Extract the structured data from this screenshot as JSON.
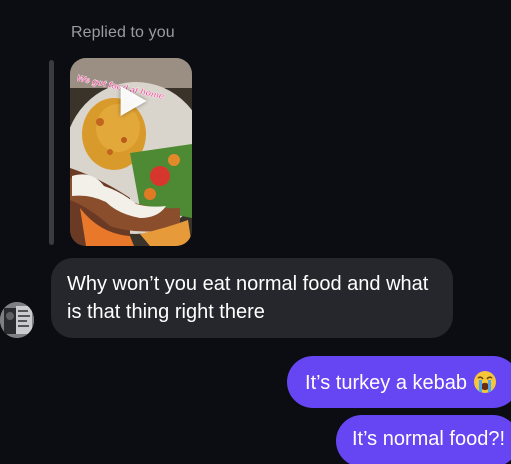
{
  "reply": {
    "label": "Replied to you",
    "video_overlay_text": "We got food at home"
  },
  "messages": {
    "incoming_text": "Why won’t you eat normal food and what is that thing right there",
    "outgoing_1": "It’s turkey a kebab",
    "outgoing_1_emoji": "loudly-crying-face",
    "outgoing_2": "It’s normal food?!"
  },
  "colors": {
    "background": "#0c0d12",
    "incoming_bubble": "#26272d",
    "outgoing_bubble": "#6646f2",
    "secondary_text": "#9a9ba3"
  }
}
